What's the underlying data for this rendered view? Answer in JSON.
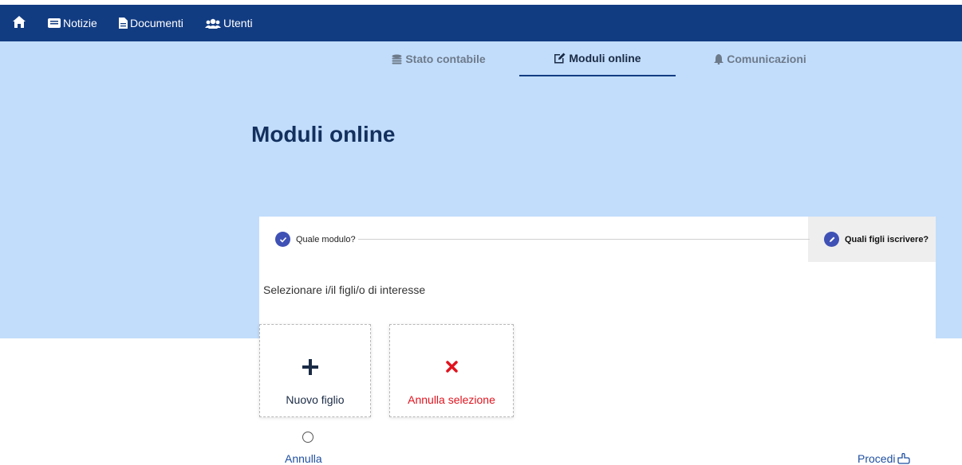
{
  "topnav": {
    "items": [
      {
        "label": ""
      },
      {
        "label": "Notizie"
      },
      {
        "label": "Documenti"
      },
      {
        "label": "Utenti"
      }
    ]
  },
  "tabs": {
    "stato": "Stato contabile",
    "moduli": "Moduli online",
    "comunicazioni": "Comunicazioni"
  },
  "page": {
    "title": "Moduli online"
  },
  "stepper": {
    "step1": "Quale modulo?",
    "step2": "Quali figli iscrivere?"
  },
  "form": {
    "instruction": "Selezionare i/il figli/o di interesse",
    "new_child": "Nuovo figlio",
    "cancel_selection": "Annulla selezione",
    "cancel": "Annulla",
    "proceed": "Procedi"
  },
  "colors": {
    "topbar": "#123c82",
    "hero": "#c2ddfb",
    "step_icon": "#3f51b5",
    "cancel_red": "#e0131e"
  }
}
